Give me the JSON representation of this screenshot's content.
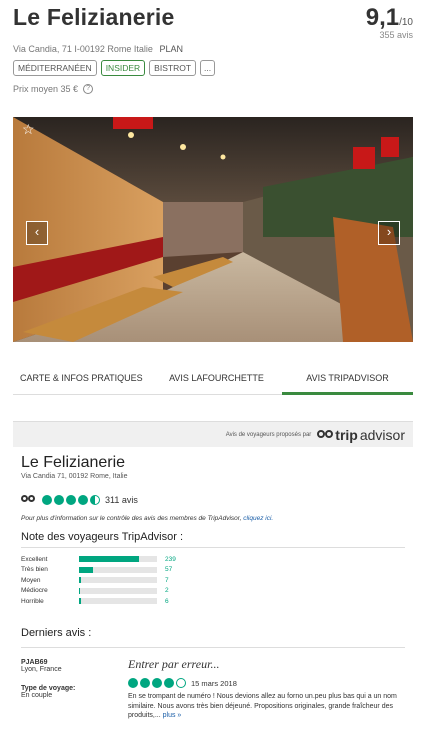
{
  "restaurant": {
    "name": "Le Felizianerie",
    "score": "9,1",
    "score_denominator": "/10",
    "review_count": "355 avis",
    "address": "Via Candia, 71 I-00192 Rome Italie",
    "plan_label": "PLAN",
    "tags": [
      "MÉDITERRANÉEN",
      "INSIDER",
      "BISTROT",
      "..."
    ],
    "price": "Prix moyen 35 €",
    "help_icon": "?"
  },
  "gallery": {
    "favorite_icon": "☆",
    "prev_icon": "‹",
    "next_icon": "›"
  },
  "tabs": [
    {
      "label": "CARTE & INFOS PRATIQUES",
      "active": false
    },
    {
      "label": "AVIS LAFOURCHETTE",
      "active": false
    },
    {
      "label": "AVIS TRIPADVISOR",
      "active": true
    }
  ],
  "tripadvisor": {
    "proposed_by": "Avis de voyageurs proposés par",
    "logo_trip": "trip",
    "logo_advisor": "advisor",
    "name": "Le Felizianerie",
    "address": "Via Candia 71, 00192 Rome, Italie",
    "rating": 4.5,
    "review_count": "311 avis",
    "note_text": "Pour plus d'information sur le contrôle des avis des membres de TripAdvisor,",
    "note_link": "cliquez ici.",
    "distribution_title": "Note des voyageurs TripAdvisor :",
    "distribution": [
      {
        "label": "Excellent",
        "count": "239",
        "value": 239
      },
      {
        "label": "Très bien",
        "count": "57",
        "value": 57
      },
      {
        "label": "Moyen",
        "count": "7",
        "value": 7
      },
      {
        "label": "Médiocre",
        "count": "2",
        "value": 2
      },
      {
        "label": "Horrible",
        "count": "6",
        "value": 6
      }
    ],
    "latest_title": "Derniers avis :",
    "review": {
      "author": "PJAB69",
      "location": "Lyon, France",
      "trip_type_label": "Type de voyage:",
      "trip_type": "En couple",
      "title": "Entrer par erreur...",
      "rating": 4,
      "date": "15 mars 2018",
      "text": "En se trompant de numéro ! Nous devions allez au forno un.peu plus bas qui a un nom similaire. Nous avons très bien déjeuné. Propositions originales, grande fraîcheur des produits,...",
      "more": "plus »"
    }
  },
  "colors": {
    "green": "#3a8a3f",
    "tripadvisor_green": "#00a680",
    "link": "#1a5ea8"
  }
}
